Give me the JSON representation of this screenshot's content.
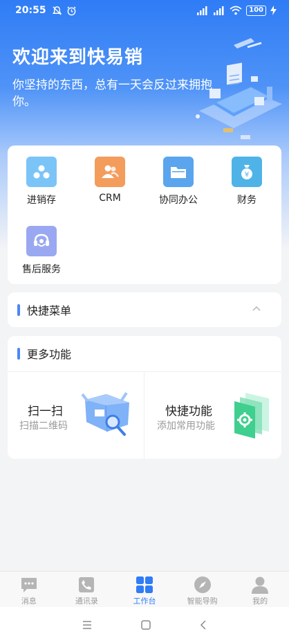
{
  "status_bar": {
    "time": "20:55",
    "battery": "100"
  },
  "welcome": {
    "title": "欢迎来到快易销",
    "subtitle": "你坚持的东西，总有一天会反过来拥抱你。"
  },
  "apps": [
    {
      "label": "进销存",
      "icon": "inventory-icon",
      "color": "#7bc4f7"
    },
    {
      "label": "CRM",
      "icon": "contacts-icon",
      "color": "#f39c5c"
    },
    {
      "label": "协同办公",
      "icon": "folder-icon",
      "color": "#5aa5ee"
    },
    {
      "label": "财务",
      "icon": "money-bag-icon",
      "color": "#4fb3e8"
    },
    {
      "label": "售后服务",
      "icon": "service-icon",
      "color": "#9aa8f2"
    }
  ],
  "quick_menu": {
    "title": "快捷菜单"
  },
  "more": {
    "title": "更多功能",
    "scan": {
      "title": "扫一扫",
      "subtitle": "扫描二维码"
    },
    "shortcut": {
      "title": "快捷功能",
      "subtitle": "添加常用功能"
    }
  },
  "tabs": [
    {
      "label": "消息",
      "icon": "message-icon"
    },
    {
      "label": "通讯录",
      "icon": "phone-icon"
    },
    {
      "label": "工作台",
      "icon": "grid-icon",
      "active": true
    },
    {
      "label": "智能导购",
      "icon": "compass-icon"
    },
    {
      "label": "我的",
      "icon": "user-icon"
    }
  ],
  "colors": {
    "accent": "#2f7cf6",
    "section_bar": "#4d86f5"
  }
}
